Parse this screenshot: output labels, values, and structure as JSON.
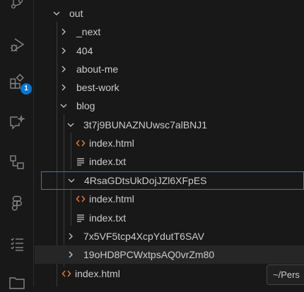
{
  "activity_bar": {
    "icons": [
      "source-control-icon",
      "run-debug-icon",
      "extensions-icon",
      "copilot-chat-icon",
      "remote-explorer-icon",
      "figma-icon",
      "outline-list-icon",
      "folder-icon"
    ],
    "extensions_badge": "1"
  },
  "explorer": {
    "items": [
      {
        "label": "out",
        "type": "folder-open",
        "depth": 0
      },
      {
        "label": "_next",
        "type": "folder-closed",
        "depth": 1
      },
      {
        "label": "404",
        "type": "folder-closed",
        "depth": 1
      },
      {
        "label": "about-me",
        "type": "folder-closed",
        "depth": 1
      },
      {
        "label": "best-work",
        "type": "folder-closed",
        "depth": 1
      },
      {
        "label": "blog",
        "type": "folder-open",
        "depth": 1
      },
      {
        "label": "3t7j9BUNAZNUwsc7alBNJ1",
        "type": "folder-open",
        "depth": 2
      },
      {
        "label": "index.html",
        "type": "html-file",
        "depth": 3
      },
      {
        "label": "index.txt",
        "type": "txt-file",
        "depth": 3
      },
      {
        "label": "4RsaGDtsUkDojJZl6XFpES",
        "type": "folder-open",
        "depth": 2,
        "focused": true
      },
      {
        "label": "index.html",
        "type": "html-file",
        "depth": 3
      },
      {
        "label": "index.txt",
        "type": "txt-file",
        "depth": 3
      },
      {
        "label": "7x5VF5tcp4XcpYdutT6SAV",
        "type": "folder-closed",
        "depth": 2
      },
      {
        "label": "19oHD8PCWxtpsAQ0vrZm80",
        "type": "folder-closed",
        "depth": 2,
        "hovered": true
      },
      {
        "label": "index.html",
        "type": "html-file",
        "depth": 1
      }
    ]
  },
  "tooltip": {
    "text": "~/Pers"
  },
  "colors": {
    "background": "#181818",
    "html_icon": "#e37933",
    "focus_border": "#2a7bd1",
    "badge": "#0078d4"
  }
}
